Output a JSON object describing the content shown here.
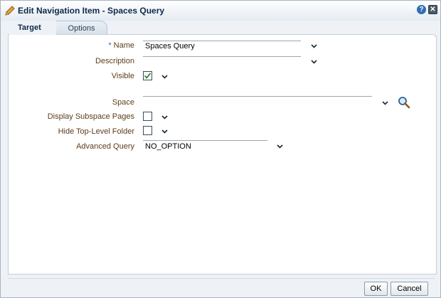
{
  "dialog": {
    "title": "Edit Navigation Item - Spaces Query",
    "help_glyph": "?",
    "close_glyph": "✕"
  },
  "tabs": [
    {
      "label": "Target",
      "selected": true
    },
    {
      "label": "Options",
      "selected": false
    }
  ],
  "form": {
    "required_marker": "*",
    "name_label": "Name",
    "name_value": "Spaces Query",
    "description_label": "Description",
    "description_value": "",
    "visible_label": "Visible",
    "visible_checked": true,
    "space_label": "Space",
    "space_value": "",
    "display_subspace_label": "Display Subspace Pages",
    "display_subspace_checked": false,
    "hide_top_level_label": "Hide Top-Level Folder",
    "hide_top_level_checked": false,
    "advanced_query_label": "Advanced Query",
    "advanced_query_value": "NO_OPTION"
  },
  "buttons": {
    "ok_label": "OK",
    "cancel_label": "Cancel"
  },
  "colors": {
    "label_brown": "#5a3d1a",
    "title_navy": "#0d2a4a",
    "accent_blue": "#2e6db5",
    "check_green": "#2a8a2a"
  }
}
